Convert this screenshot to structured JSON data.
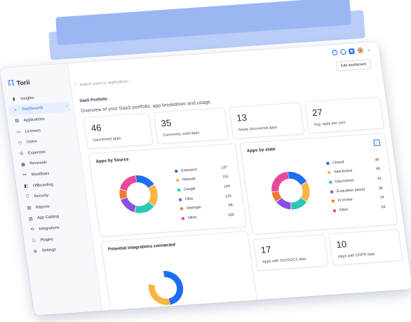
{
  "app": {
    "logo": "Torii"
  },
  "sidebar": {
    "items": [
      {
        "label": "Insights",
        "icon": "chart-icon",
        "glyph": "▮"
      },
      {
        "label": "Dashboards",
        "icon": "dashboard-icon",
        "glyph": "◒",
        "active": true,
        "chevron": "›"
      },
      {
        "label": "Applications",
        "icon": "apps-icon",
        "glyph": "▤"
      },
      {
        "label": "Licenses",
        "icon": "license-icon",
        "glyph": "▭"
      },
      {
        "label": "Users",
        "icon": "users-icon",
        "glyph": "⚇"
      },
      {
        "label": "Expenses",
        "icon": "expenses-icon",
        "glyph": "◎"
      },
      {
        "label": "Renewals",
        "icon": "renewals-icon",
        "glyph": "▦"
      },
      {
        "label": "Workflows",
        "icon": "workflows-icon",
        "glyph": "⚯"
      },
      {
        "label": "Offboarding",
        "icon": "offboarding-icon",
        "glyph": "◧"
      },
      {
        "label": "Security",
        "icon": "shield-icon",
        "glyph": "⛉"
      },
      {
        "label": "Reports",
        "icon": "reports-icon",
        "glyph": "▧"
      },
      {
        "label": "App Catalog",
        "icon": "catalog-icon",
        "glyph": "▥"
      },
      {
        "label": "Integrations",
        "icon": "integrations-icon",
        "glyph": "⟲"
      },
      {
        "label": "Plugins",
        "icon": "plugins-icon",
        "glyph": "⬡"
      },
      {
        "label": "Settings",
        "icon": "gear-icon",
        "glyph": "⚙"
      }
    ]
  },
  "topbar": {
    "search_placeholder": "Search users or applications...",
    "edit_button": "Edit dashboard",
    "help_glyph": "?",
    "chat_glyph": "…",
    "apps_glyph": "▦",
    "avatar_glyph": "●",
    "chevron_glyph": "⌄"
  },
  "header": {
    "title": "SaaS Portfolio",
    "subtitle": "Overview of your SaaS portfolio, app breakdown and usage."
  },
  "stats": [
    {
      "value": "46",
      "label": "Sanctioned apps"
    },
    {
      "value": "35",
      "label": "Commonly used apps"
    },
    {
      "value": "13",
      "label": "Newly discovered apps"
    },
    {
      "value": "27",
      "label": "Avg. apps per user"
    }
  ],
  "bottom_stats": [
    {
      "value": "17",
      "label": "Apps with ISO/SOC2 data"
    },
    {
      "value": "10",
      "label": "Apps with GDPR data"
    }
  ],
  "integrations_card": {
    "title": "Potential integrations connected"
  },
  "chart_data": [
    {
      "type": "pie",
      "title": "Apps by Source",
      "categories": [
        "Extension",
        "Netsuite",
        "Google",
        "Okta",
        "Onelogin",
        "Other"
      ],
      "values": [
        137,
        151,
        144,
        124,
        68,
        150
      ],
      "colors": [
        "#1d6ef2",
        "#f7b544",
        "#2ec4b6",
        "#8a4fe0",
        "#f07a2e",
        "#e8489a"
      ]
    },
    {
      "type": "pie",
      "title": "Apps by state",
      "categories": [
        "Closed",
        "Sanctioned",
        "Discovered",
        "Evaluation period",
        "In review",
        "Other"
      ],
      "values": [
        48,
        46,
        41,
        36,
        24,
        64
      ],
      "colors": [
        "#1d6ef2",
        "#f7b544",
        "#2ec4b6",
        "#8a4fe0",
        "#f07a2e",
        "#e8489a"
      ]
    }
  ]
}
